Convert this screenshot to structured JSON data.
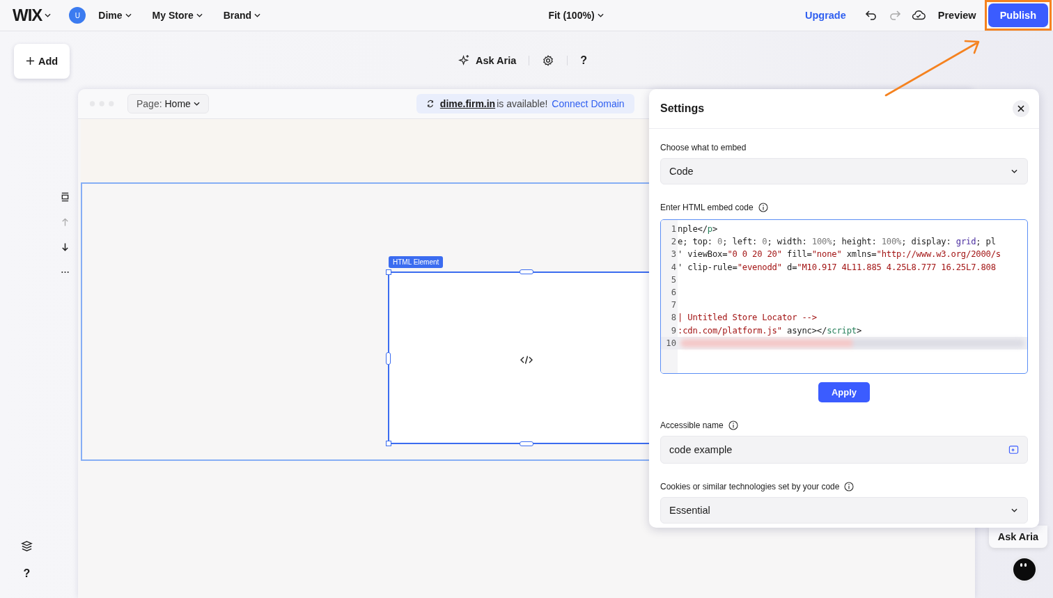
{
  "topbar": {
    "logo": "WIX",
    "avatar": "U",
    "menus": [
      "Dime",
      "My Store",
      "Brand"
    ],
    "zoom": "Fit (100%)",
    "upgrade": "Upgrade",
    "redo_disabled": true,
    "preview": "Preview",
    "publish": "Publish"
  },
  "toolbar": {
    "add": "Add",
    "ask_aria": "Ask Aria",
    "help": "?"
  },
  "frame": {
    "page_label": "Page:",
    "page_name": "Home",
    "domain": "dime.firm.in",
    "domain_text": "is available!",
    "connect": "Connect Domain"
  },
  "element": {
    "label": "HTML Element"
  },
  "sidebar": {
    "help": "?"
  },
  "settings": {
    "title": "Settings",
    "embed_label": "Choose what to embed",
    "embed_value": "Code",
    "code_label": "Enter HTML embed code",
    "code_lines": [
      {
        "number": "1",
        "tokens": [
          {
            "text": "nple</",
            "kind": "plain"
          },
          {
            "text": "p",
            "kind": "tag"
          },
          {
            "text": ">",
            "kind": "plain"
          }
        ]
      },
      {
        "number": "2",
        "tokens": [
          {
            "text": "e; top: ",
            "kind": "plain"
          },
          {
            "text": "0",
            "kind": "number"
          },
          {
            "text": "; left: ",
            "kind": "plain"
          },
          {
            "text": "0",
            "kind": "number"
          },
          {
            "text": "; width: ",
            "kind": "plain"
          },
          {
            "text": "100%",
            "kind": "number"
          },
          {
            "text": "; height: ",
            "kind": "plain"
          },
          {
            "text": "100%",
            "kind": "number"
          },
          {
            "text": "; display: ",
            "kind": "plain"
          },
          {
            "text": "grid",
            "kind": "keyword"
          },
          {
            "text": "; pl",
            "kind": "plain"
          }
        ]
      },
      {
        "number": "3",
        "tokens": [
          {
            "text": "' viewBox=",
            "kind": "plain"
          },
          {
            "text": "\"0 0 20 20\"",
            "kind": "string"
          },
          {
            "text": " fill=",
            "kind": "plain"
          },
          {
            "text": "\"none\"",
            "kind": "string"
          },
          {
            "text": " xmlns=",
            "kind": "plain"
          },
          {
            "text": "\"http://www.w3.org/2000/s",
            "kind": "string"
          }
        ]
      },
      {
        "number": "4",
        "tokens": [
          {
            "text": "' clip-rule=",
            "kind": "plain"
          },
          {
            "text": "\"evenodd\"",
            "kind": "string"
          },
          {
            "text": " d=",
            "kind": "plain"
          },
          {
            "text": "\"M10.917 4L11.885 4.25L8.777 16.25L7.808",
            "kind": "string"
          }
        ]
      },
      {
        "number": "5"
      },
      {
        "number": "6"
      },
      {
        "number": "7"
      },
      {
        "number": "8",
        "tokens": [
          {
            "text": "| Untitled Store Locator -->",
            "kind": "string"
          }
        ]
      },
      {
        "number": "9",
        "tokens": [
          {
            "text": ":cdn.com/platform.js\"",
            "kind": "string"
          },
          {
            "text": " async></",
            "kind": "plain"
          },
          {
            "text": "script",
            "kind": "tag"
          },
          {
            "text": ">",
            "kind": "plain"
          }
        ]
      },
      {
        "number": "10",
        "redacted": true
      }
    ],
    "apply": "Apply",
    "name_label": "Accessible name",
    "name_value": "code example",
    "cookies_label": "Cookies or similar technologies set by your code",
    "cookies_value": "Essential"
  },
  "aria_tab": "Ask Aria"
}
